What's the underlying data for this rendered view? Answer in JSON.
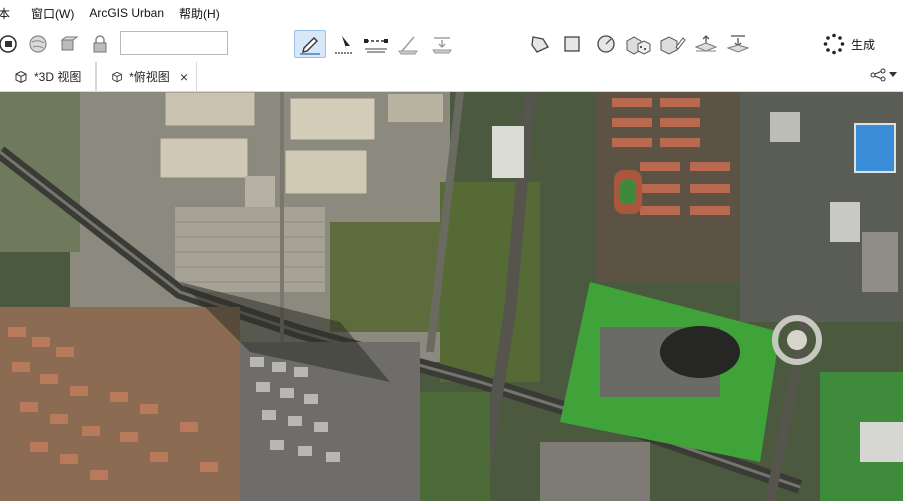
{
  "menu": {
    "items": [
      "本",
      "窗口(W)",
      "ArcGIS Urban",
      "帮助(H)"
    ]
  },
  "toolbar": {
    "search_value": "",
    "generate_label": "生成",
    "icons": [
      "globe-layer-icon",
      "globe-icon",
      "cube-select-icon",
      "lock-icon",
      "sketch-pen-icon",
      "arrow-select-icon",
      "vertex-line-icon",
      "scale-plane-icon",
      "project-down-icon",
      "polygon-shape-icon",
      "square-shape-icon",
      "circle-shape-icon",
      "cube-multiple-icon",
      "cube-edit-icon",
      "plane-up-icon",
      "plane-down-icon",
      "generate-spinner-icon"
    ],
    "active_tool": "sketch-pen-icon"
  },
  "tabs": [
    {
      "label": "*3D 视图",
      "active": false,
      "closable": false
    },
    {
      "label": "*俯视图",
      "active": true,
      "closable": true
    }
  ],
  "tab_close_glyph": "×",
  "colors": {
    "active_tool_bg": "#d6e7f7",
    "map_dark": "#3d4a35",
    "park_green": "#3fa33a",
    "roof_blue": "#3a8ed8"
  }
}
